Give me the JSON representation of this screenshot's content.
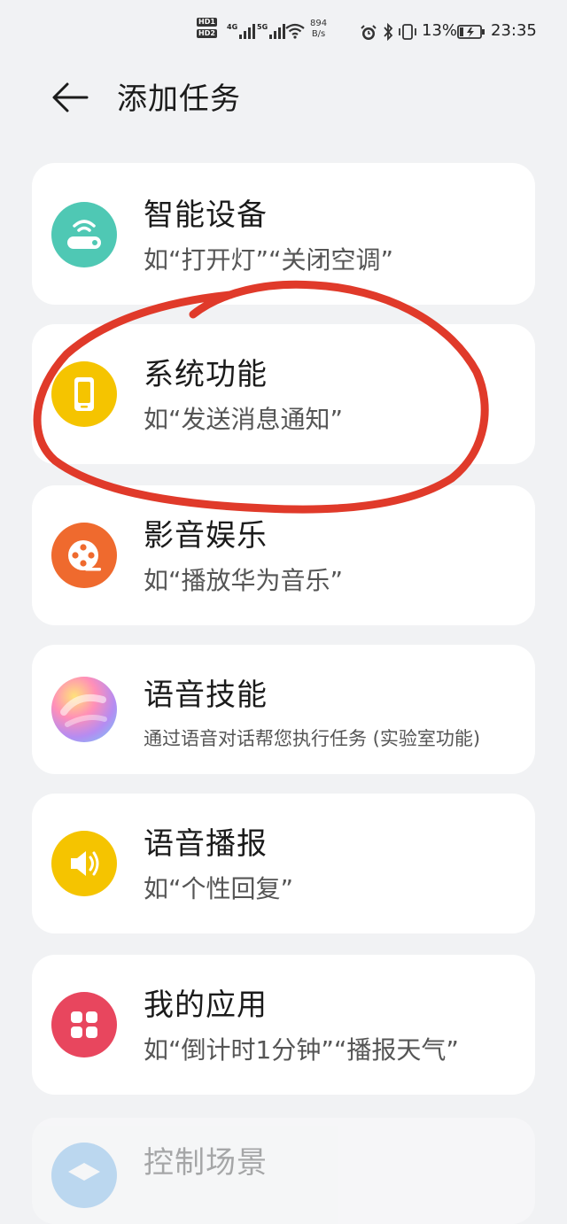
{
  "status_bar": {
    "hd1": "HD1",
    "hd2": "HD2",
    "net1": "4G",
    "net2": "5G",
    "speed_value": "894",
    "speed_unit": "B/s",
    "battery": "13%",
    "time": "23:35"
  },
  "header": {
    "title": "添加任务"
  },
  "items": [
    {
      "name": "智能设备",
      "desc": "如“打开灯”“关闭空调”",
      "icon": "router-icon",
      "color": "#4fc8b4"
    },
    {
      "name": "系统功能",
      "desc": "如“发送消息通知”",
      "icon": "phone-icon",
      "color": "#f5c400"
    },
    {
      "name": "影音娱乐",
      "desc": "如“播放华为音乐”",
      "icon": "film-reel-icon",
      "color": "#ef6a2e"
    },
    {
      "name": "语音技能",
      "desc": "通过语音对话帮您执行任务 (实验室功能)",
      "icon": "voice-assistant-icon",
      "color": "#c98ae0"
    },
    {
      "name": "语音播报",
      "desc": "如“个性回复”",
      "icon": "speaker-icon",
      "color": "#f5c400"
    },
    {
      "name": "我的应用",
      "desc": "如“倒计时1分钟”“播报天气”",
      "icon": "apps-grid-icon",
      "color": "#e8465e"
    },
    {
      "name": "控制场景",
      "desc": "",
      "icon": "layers-icon",
      "color": "#5aa7e8"
    }
  ],
  "colors": {
    "background": "#f1f2f4",
    "card": "#ffffff",
    "annotation": "#e03a2a"
  }
}
